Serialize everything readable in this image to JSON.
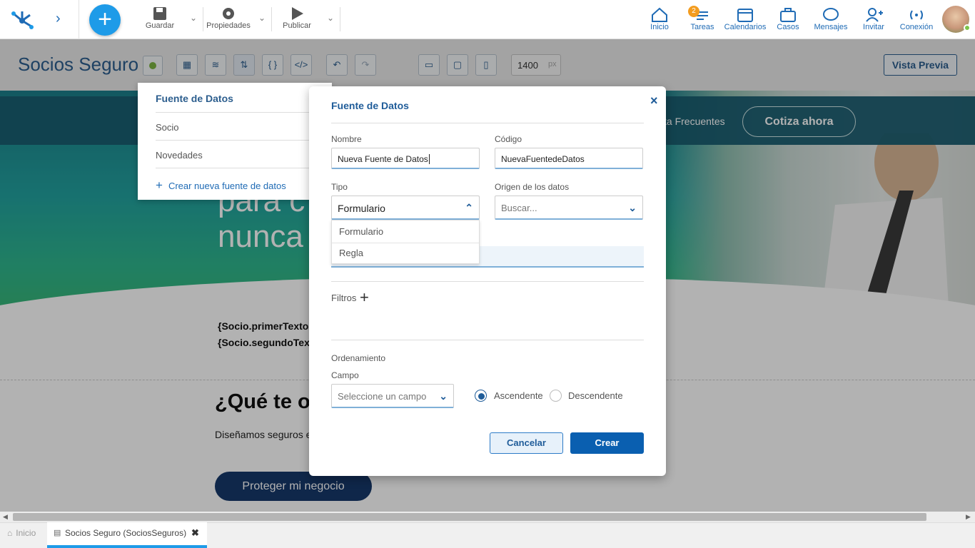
{
  "toolbar": {
    "save_label": "Guardar",
    "properties_label": "Propiedades",
    "publish_label": "Publicar"
  },
  "nav": {
    "home": "Inicio",
    "tasks": "Tareas",
    "tasks_badge": "2",
    "calendars": "Calendarios",
    "cases": "Casos",
    "messages": "Mensajes",
    "invite": "Invitar",
    "connection": "Conexión"
  },
  "editor": {
    "title": "Socios Seguro",
    "width_value": "1400",
    "width_unit": "px",
    "preview_label": "Vista Previa"
  },
  "canvas": {
    "faq_label": "ta Frecuentes",
    "quote_button": "Cotiza ahora",
    "hero_line1": "para c",
    "hero_line2": "nunca",
    "template_line1": "{Socio.primerTexto",
    "template_line2": "{Socio.segundoTex",
    "offer_title": "¿Qué te of",
    "offer_desc": "Diseñamos seguros e",
    "protect_button": "Proteger mi negocio"
  },
  "ds_menu": {
    "header": "Fuente de Datos",
    "items": [
      "Socio",
      "Novedades"
    ],
    "create_label": "Crear nueva fuente de datos"
  },
  "modal": {
    "title": "Fuente de Datos",
    "name_label": "Nombre",
    "name_value": "Nueva Fuente de Datos",
    "code_label": "Código",
    "code_value": "NuevaFuentedeDatos",
    "type_label": "Tipo",
    "type_value": "Formulario",
    "type_options": [
      "Formulario",
      "Regla"
    ],
    "origin_label": "Origen de los datos",
    "origin_placeholder": "Buscar...",
    "filters_label": "Filtros",
    "ordering_label": "Ordenamiento",
    "field_label": "Campo",
    "field_placeholder": "Seleccione un campo",
    "asc_label": "Ascendente",
    "desc_label": "Descendente",
    "sort_selected": "Ascendente",
    "cancel_label": "Cancelar",
    "create_label": "Crear"
  },
  "tabs": {
    "home": "Inicio",
    "active": "Socios Seguro (SociosSeguros)"
  },
  "colors": {
    "accent": "#1e9be8",
    "primary": "#1f5c99",
    "dark_button": "#16386b"
  }
}
